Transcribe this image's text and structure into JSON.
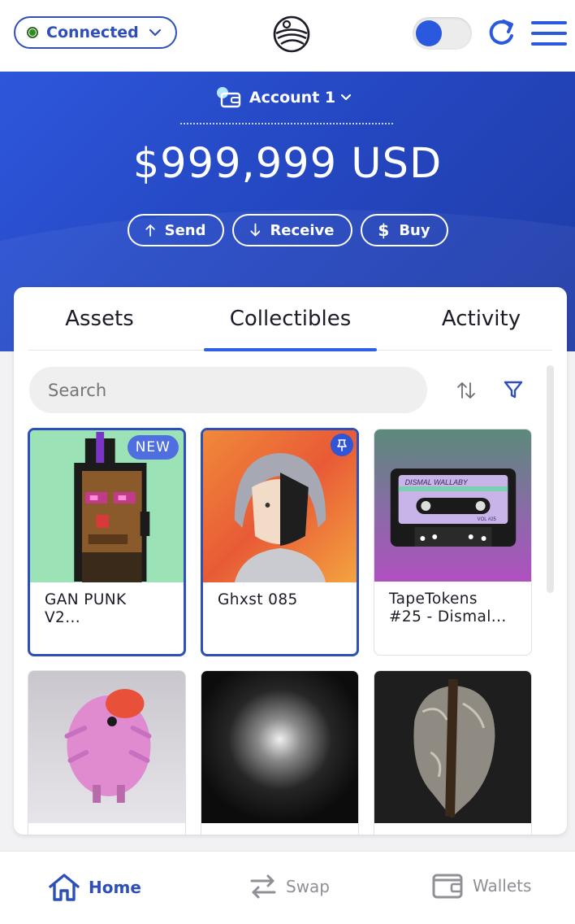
{
  "header": {
    "connection_label": "Connected",
    "connection_color": "#2e8b22",
    "logo_icon": "swirl-logo-icon",
    "theme_toggle_on": true,
    "refresh_icon": "refresh-icon",
    "menu_icon": "hamburger-menu-icon"
  },
  "hero": {
    "account_name": "Account 1",
    "balance": "$999,999 USD",
    "actions": {
      "send": "Send",
      "receive": "Receive",
      "buy": "Buy"
    },
    "accent_color": "#2446c0"
  },
  "tabs": {
    "assets": "Assets",
    "collectibles": "Collectibles",
    "activity": "Activity",
    "active": "Collectibles"
  },
  "search": {
    "placeholder": "Search",
    "value": ""
  },
  "collectibles": [
    {
      "name_line1": "GAN PUNK",
      "name_line2": "V2...",
      "badge": "NEW",
      "selected": true
    },
    {
      "name_line1": "Ghxst 085",
      "name_line2": "",
      "badge": "pin-icon",
      "selected": true
    },
    {
      "name_line1": "TapeTokens",
      "name_line2": "#25 - Dismal...",
      "badge": "",
      "selected": false,
      "image_text_1": "DISMAL WALLABY",
      "image_text_2": "VOL #25"
    },
    {
      "name_line1": "",
      "name_line2": "",
      "badge": "",
      "selected": false
    },
    {
      "name_line1": "",
      "name_line2": "",
      "badge": "",
      "selected": false
    },
    {
      "name_line1": "",
      "name_line2": "",
      "badge": "",
      "selected": false
    }
  ],
  "bottom_nav": {
    "home": "Home",
    "swap": "Swap",
    "wallets": "Wallets",
    "active": "Home"
  }
}
